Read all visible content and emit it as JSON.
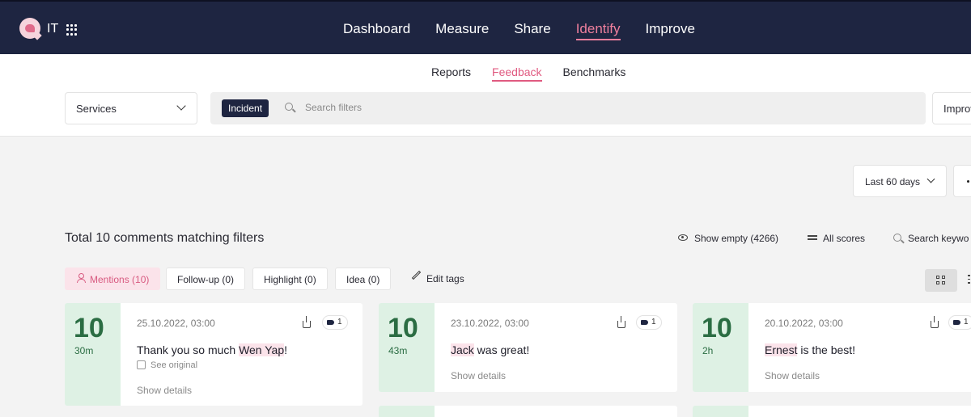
{
  "app": {
    "brand": "IT"
  },
  "topnav": {
    "items": [
      {
        "label": "Dashboard",
        "active": false
      },
      {
        "label": "Measure",
        "active": false
      },
      {
        "label": "Share",
        "active": false
      },
      {
        "label": "Identify",
        "active": true
      },
      {
        "label": "Improve",
        "active": false
      }
    ]
  },
  "subnav": {
    "items": [
      {
        "label": "Reports",
        "active": false
      },
      {
        "label": "Feedback",
        "active": true
      },
      {
        "label": "Benchmarks",
        "active": false
      }
    ]
  },
  "filters": {
    "service_select": "Services",
    "chip": "Incident",
    "search_placeholder": "Search filters",
    "right_select": "Improv"
  },
  "range": {
    "label": "Last 60 days"
  },
  "results": {
    "total": "Total 10 comments matching filters",
    "show_empty": "Show empty (4266)",
    "all_scores": "All scores",
    "search_keywords": "Search keywo"
  },
  "tags": {
    "mentions": "Mentions (10)",
    "followup": "Follow-up (0)",
    "highlight": "Highlight (0)",
    "idea": "Idea (0)",
    "edit": "Edit tags"
  },
  "cards": [
    {
      "score": "10",
      "ago": "30m",
      "date": "25.10.2022, 03:00",
      "text_before": "Thank you so much ",
      "mention": "Wen Yap",
      "text_after": "!",
      "see_original": "See original",
      "details": "Show details",
      "tag_count": "1"
    },
    {
      "score": "10",
      "ago": "43m",
      "date": "23.10.2022, 03:00",
      "text_before": "",
      "mention": "Jack",
      "text_after": " was great!",
      "details": "Show details",
      "tag_count": "1"
    },
    {
      "score": "10",
      "ago": "2h",
      "date": "20.10.2022, 03:00",
      "text_before": "",
      "mention": "Ernest",
      "text_after": " is the best!",
      "details": "Show details",
      "tag_count": "1"
    }
  ],
  "colors": {
    "navbar": "#1e2541",
    "accent_pink": "#e05a80",
    "score_bg": "#def1e4",
    "score_text": "#2b6d43"
  }
}
